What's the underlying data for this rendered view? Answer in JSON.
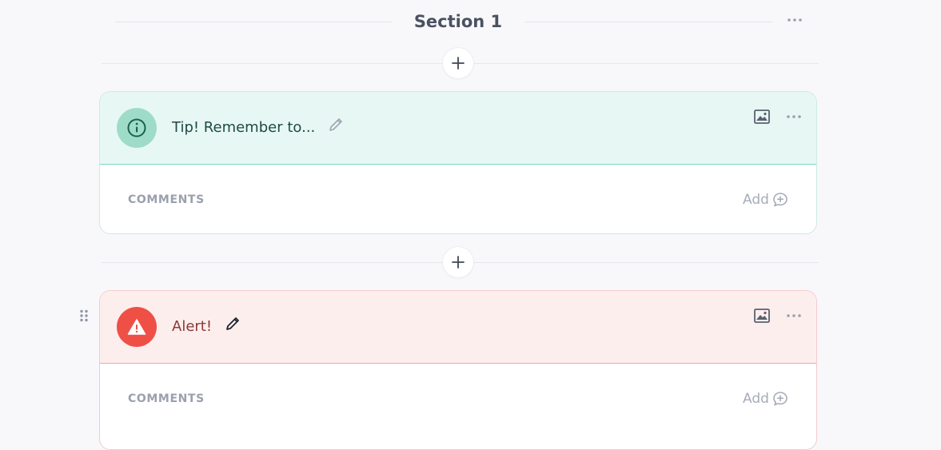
{
  "section": {
    "title": "Section 1"
  },
  "blocks": [
    {
      "type": "tip",
      "title": "Tip! Remember to...",
      "icon": "info-icon",
      "comments_label": "COMMENTS",
      "add_label": "Add"
    },
    {
      "type": "alert",
      "title": "Alert!",
      "icon": "warning-icon",
      "comments_label": "COMMENTS",
      "add_label": "Add"
    }
  ],
  "colors": {
    "tip_header_bg": "#e7f8f4",
    "tip_badge": "#9fdcc8",
    "alert_header_bg": "#fdeeee",
    "alert_badge": "#ef5046"
  }
}
